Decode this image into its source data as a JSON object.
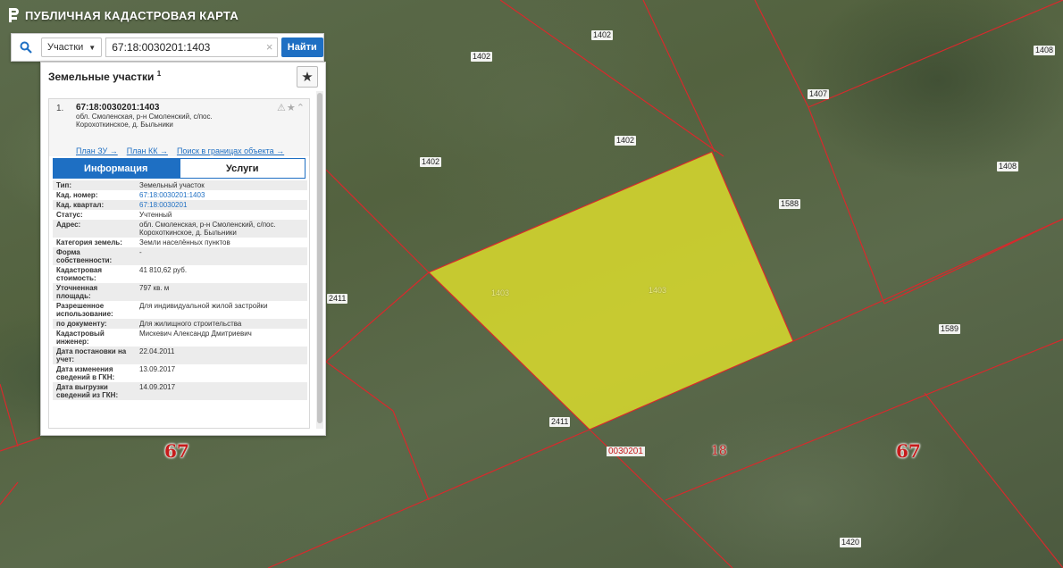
{
  "header": {
    "title": "ПУБЛИЧНАЯ КАДАСТРОВАЯ КАРТА"
  },
  "search": {
    "type_label": "Участки",
    "query": "67:18:0030201:1403",
    "button_label": "Найти"
  },
  "panel": {
    "title": "Земельные участки",
    "title_count": "1",
    "result": {
      "index": "1.",
      "cadastral_number": "67:18:0030201:1403",
      "address": "обл. Смоленская, р-н Смоленский, с/пос. Корохоткинское, д. Быльники",
      "links": {
        "plan_zu": "План ЗУ →",
        "plan_kk": "План КК →",
        "search_bounds": "Поиск в границах объекта →"
      }
    },
    "tabs": {
      "info": "Информация",
      "services": "Услуги"
    },
    "attributes": [
      {
        "key": "Тип:",
        "value": "Земельный участок",
        "link": false
      },
      {
        "key": "Кад. номер:",
        "value": "67:18:0030201:1403",
        "link": true
      },
      {
        "key": "Кад. квартал:",
        "value": "67:18:0030201",
        "link": true
      },
      {
        "key": "Статус:",
        "value": "Учтенный",
        "link": false
      },
      {
        "key": "Адрес:",
        "value": "обл. Смоленская, р-н Смоленский, с/пос. Корохоткинское, д. Быльники",
        "link": false
      },
      {
        "key": "Категория земель:",
        "value": "Земли населённых пунктов",
        "link": false
      },
      {
        "key": "Форма собственности:",
        "value": "-",
        "link": false
      },
      {
        "key": "Кадастровая стоимость:",
        "value": "41 810,62 руб.",
        "link": false
      },
      {
        "key": "Уточненная площадь:",
        "value": "797 кв. м",
        "link": false
      },
      {
        "key": "Разрешенное использование:",
        "value": "Для индивидуальной жилой застройки",
        "link": false
      },
      {
        "key": "по документу:",
        "value": "Для жилищного строительства",
        "link": false
      },
      {
        "key": "Кадастровый инженер:",
        "value": "Мискевич Александр Дмитриевич",
        "link": false
      },
      {
        "key": "Дата постановки на учет:",
        "value": "22.04.2011",
        "link": false
      },
      {
        "key": "Дата изменения сведений в ГКН:",
        "value": "13.09.2017",
        "link": false
      },
      {
        "key": "Дата выгрузки сведений из ГКН:",
        "value": "14.09.2017",
        "link": false
      }
    ]
  },
  "map": {
    "parcel_labels": [
      "1402",
      "1402",
      "1408",
      "1407",
      "1402",
      "1402",
      "1408",
      "1588",
      "1403",
      "1403",
      "1589",
      "2411",
      "2411",
      "1420"
    ],
    "district_labels": [
      "67",
      "67"
    ],
    "region_label": "18",
    "quarter_label": "0030201"
  },
  "colors": {
    "accent": "#1e6fc3",
    "boundary": "#d8292c",
    "selected_fill": "#e6e62a"
  }
}
